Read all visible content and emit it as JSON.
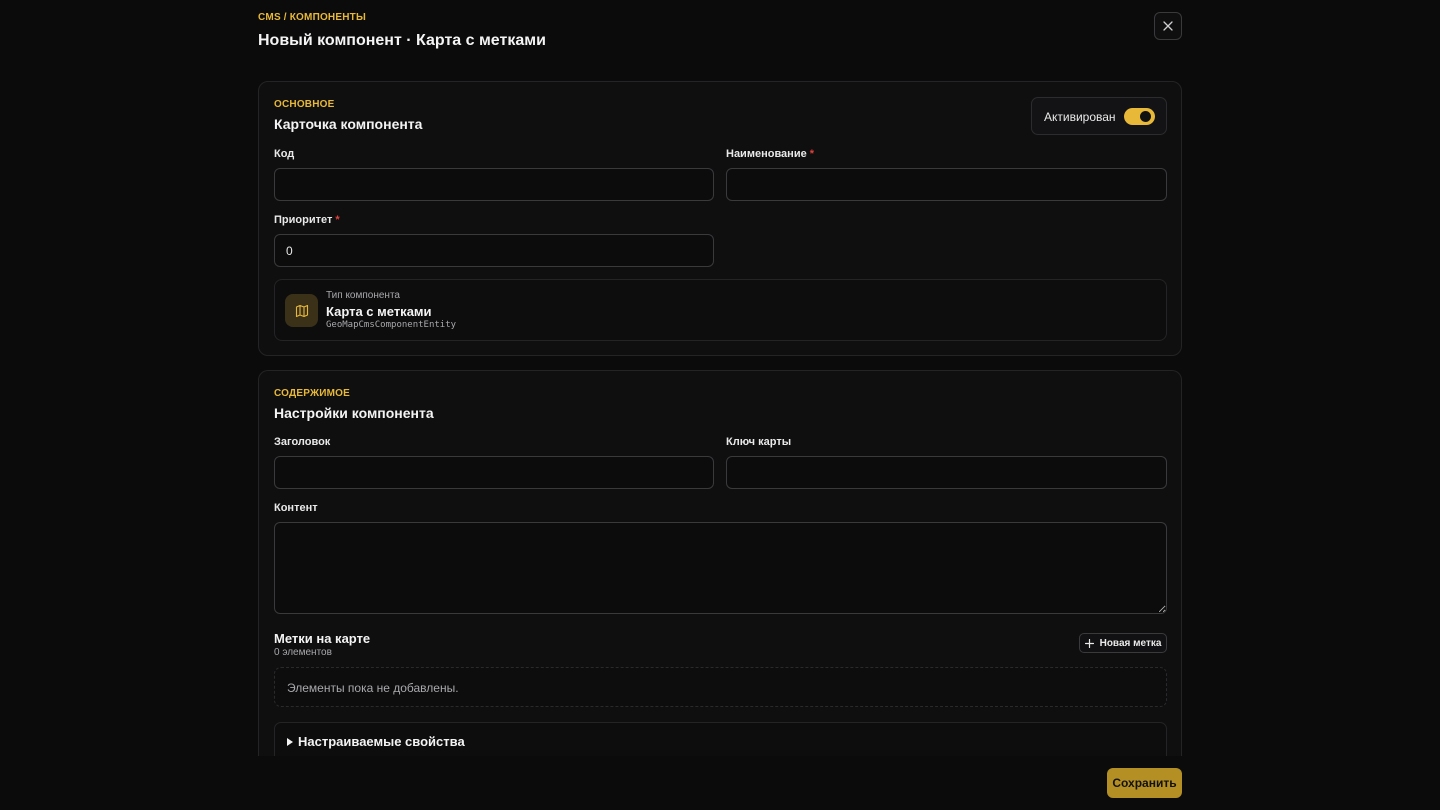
{
  "header": {
    "breadcrumb": "CMS / КОМПОНЕНТЫ",
    "title": "Новый компонент · Карта с метками",
    "close_icon": "close-icon"
  },
  "basic": {
    "eyebrow": "ОСНОВНОЕ",
    "title": "Карточка компонента",
    "toggle_label": "Активирован",
    "toggle_on": true,
    "code_label": "Код",
    "code_value": "",
    "name_label": "Наименование",
    "required_mark": "*",
    "name_value": "",
    "priority_label": "Приоритет",
    "priority_value": "0",
    "type_caption": "Тип компонента",
    "type_name": "Карта с метками",
    "type_entity": "GeoMapCmsComponentEntity",
    "type_icon": "map-icon"
  },
  "content": {
    "eyebrow": "СОДЕРЖИМОЕ",
    "title": "Настройки компонента",
    "heading_label": "Заголовок",
    "heading_value": "",
    "map_key_label": "Ключ карты",
    "map_key_value": "",
    "content_label": "Контент",
    "content_value": "",
    "markers_title": "Метки на карте",
    "markers_count": "0 элементов",
    "add_marker_label": "Новая метка",
    "empty_text": "Элементы пока не добавлены.",
    "custom_props_label": "Настраиваемые свойства"
  },
  "footer": {
    "save_label": "Сохранить"
  },
  "colors": {
    "accent": "#e8b838",
    "background": "#0b0b0c",
    "required": "#e0413c"
  }
}
